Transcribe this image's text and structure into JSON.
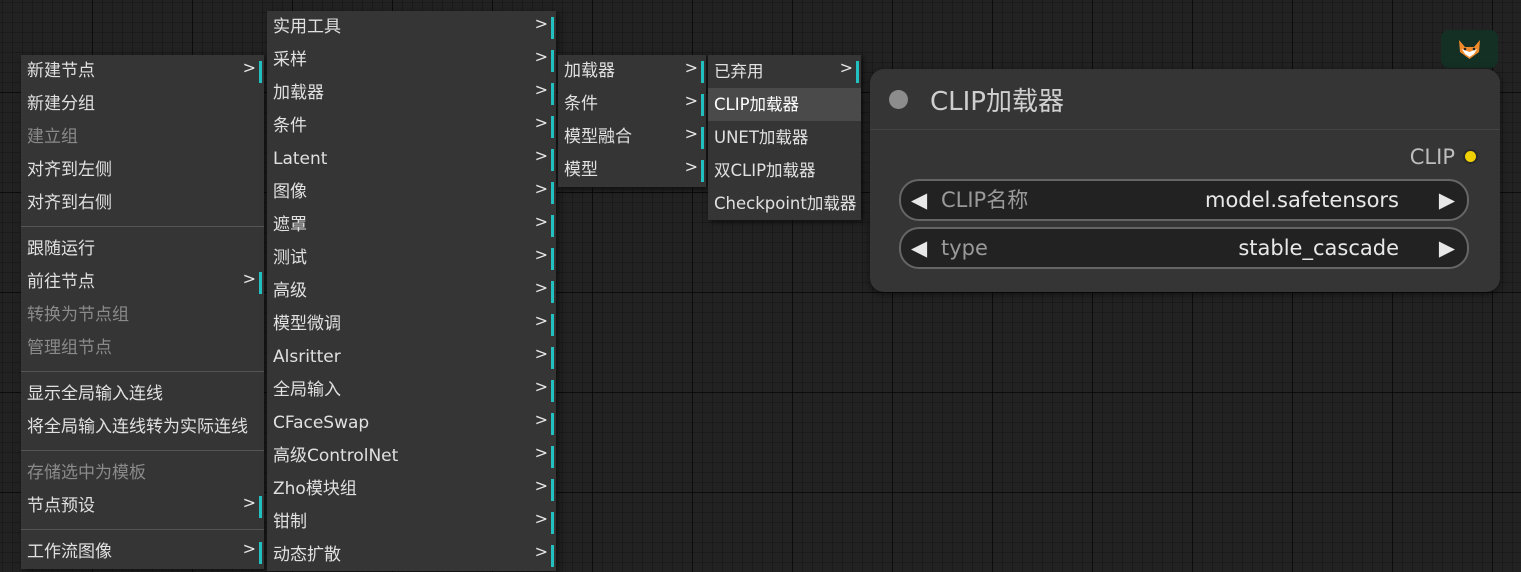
{
  "main_menu": {
    "items": [
      {
        "label": "新建节点",
        "submenu": true,
        "disabled": false
      },
      {
        "label": "新建分组",
        "submenu": false,
        "disabled": false
      },
      {
        "label": "建立组",
        "submenu": false,
        "disabled": true
      },
      {
        "label": "对齐到左侧",
        "submenu": false,
        "disabled": false
      },
      {
        "label": "对齐到右侧",
        "submenu": false,
        "disabled": false
      },
      {
        "label": "跟随运行",
        "submenu": false,
        "disabled": false
      },
      {
        "label": "前往节点",
        "submenu": true,
        "disabled": false
      },
      {
        "label": "转换为节点组",
        "submenu": false,
        "disabled": true
      },
      {
        "label": "管理组节点",
        "submenu": false,
        "disabled": true
      },
      {
        "label": "显示全局输入连线",
        "submenu": false,
        "disabled": false
      },
      {
        "label": "将全局输入连线转为实际连线",
        "submenu": false,
        "disabled": false
      },
      {
        "label": "存储选中为模板",
        "submenu": false,
        "disabled": true
      },
      {
        "label": "节点预设",
        "submenu": true,
        "disabled": false
      },
      {
        "label": "工作流图像",
        "submenu": true,
        "disabled": false
      }
    ]
  },
  "category_menu": {
    "items": [
      {
        "label": "实用工具"
      },
      {
        "label": "采样"
      },
      {
        "label": "加载器"
      },
      {
        "label": "条件"
      },
      {
        "label": "Latent"
      },
      {
        "label": "图像"
      },
      {
        "label": "遮罩"
      },
      {
        "label": "测试"
      },
      {
        "label": "高级"
      },
      {
        "label": "模型微调"
      },
      {
        "label": "Alsritter"
      },
      {
        "label": "全局输入"
      },
      {
        "label": "CFaceSwap"
      },
      {
        "label": "高级ControlNet"
      },
      {
        "label": "Zho模块组"
      },
      {
        "label": "钳制"
      },
      {
        "label": "动态扩散"
      }
    ]
  },
  "sub_menu": {
    "items": [
      {
        "label": "加载器"
      },
      {
        "label": "条件"
      },
      {
        "label": "模型融合"
      },
      {
        "label": "模型"
      }
    ]
  },
  "loader_menu": {
    "items": [
      {
        "label": "已弃用",
        "submenu": true
      },
      {
        "label": "CLIP加载器",
        "submenu": false
      },
      {
        "label": "UNET加载器",
        "submenu": false
      },
      {
        "label": "双CLIP加载器",
        "submenu": false
      },
      {
        "label": "Checkpoint加载器",
        "submenu": false
      }
    ]
  },
  "arrow_glyph": ">",
  "node": {
    "title": "CLIP加载器",
    "output_label": "CLIP",
    "widgets": [
      {
        "label": "CLIP名称",
        "value": "model.safetensors"
      },
      {
        "label": "type",
        "value": "stable_cascade"
      }
    ],
    "left_arrow": "◀",
    "right_arrow": "▶"
  },
  "colors": {
    "accent_bar": "#22c0c0",
    "output_dot": "#f0d000",
    "node_bg": "#353535",
    "menu_bg": "#353535"
  },
  "icons": {
    "fox_badge": "fox-icon"
  }
}
